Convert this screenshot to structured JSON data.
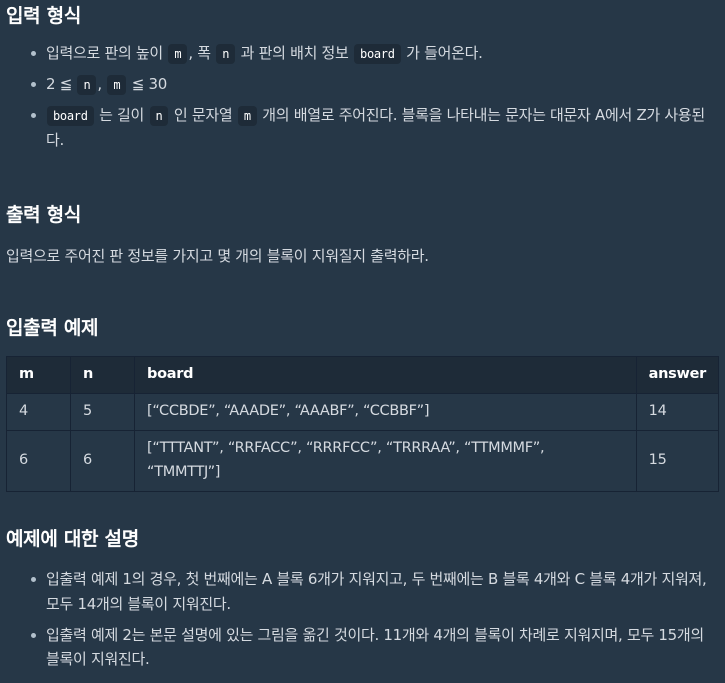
{
  "input_section": {
    "title": "입력 형식",
    "item1": {
      "t1": "입력으로 판의 높이 ",
      "c1": "m",
      "t2": ", 폭 ",
      "c2": "n",
      "t3": " 과 판의 배치 정보 ",
      "c3": "board",
      "t4": " 가 들어온다."
    },
    "item2": {
      "t1": "2 ≦ ",
      "c1": "n",
      "t2": ", ",
      "c2": "m",
      "t3": " ≦ 30"
    },
    "item3": {
      "c1": "board",
      "t1": " 는 길이 ",
      "c2": "n",
      "t2": " 인 문자열 ",
      "c3": "m",
      "t3": " 개의 배열로 주어진다. 블록을 나타내는 문자는 대문자 A에서 Z가 사용된다."
    }
  },
  "output_section": {
    "title": "출력 형식",
    "text": "입력으로 주어진 판 정보를 가지고 몇 개의 블록이 지워질지 출력하라."
  },
  "example_section": {
    "title": "입출력 예제",
    "headers": [
      "m",
      "n",
      "board",
      "answer"
    ],
    "rows": [
      [
        "4",
        "5",
        "[“CCBDE”, “AAADE”, “AAABF”, “CCBBF”]",
        "14"
      ],
      [
        "6",
        "6",
        "[“TTTANT”, “RRFACC”, “RRRFCC”, “TRRRAA”, “TTMMMF”, “TMMTTJ”]",
        "15"
      ]
    ]
  },
  "explain_section": {
    "title": "예제에 대한 설명",
    "items": [
      "입출력 예제 1의 경우, 첫 번째에는 A 블록 6개가 지워지고, 두 번째에는 B 블록 4개와 C 블록 4개가 지워져, 모두 14개의 블록이 지워진다.",
      "입출력 예제 2는 본문 설명에 있는 그림을 옮긴 것이다. 11개와 4개의 블록이 차례로 지워지며, 모두 15개의 블록이 지워진다."
    ]
  }
}
